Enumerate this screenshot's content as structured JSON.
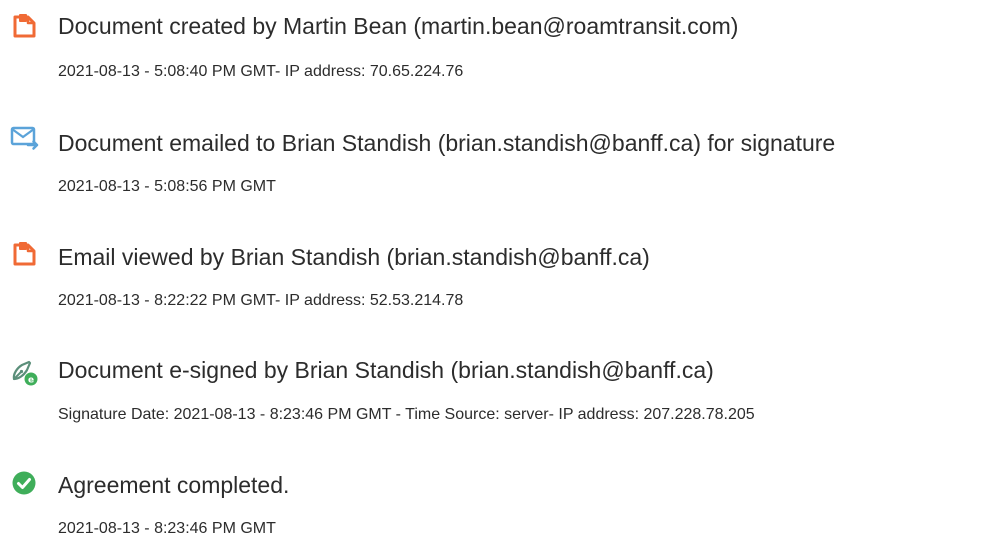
{
  "events": [
    {
      "icon": "document-orange-icon",
      "title": "Document created by Martin Bean (martin.bean@roamtransit.com)",
      "detail": "2021-08-13 - 5:08:40 PM GMT- IP address: 70.65.224.76"
    },
    {
      "icon": "email-send-icon",
      "title": "Document emailed to Brian Standish (brian.standish@banff.ca) for signature",
      "detail": "2021-08-13 - 5:08:56 PM GMT"
    },
    {
      "icon": "document-orange-icon",
      "title": "Email viewed by Brian Standish (brian.standish@banff.ca)",
      "detail": "2021-08-13 - 8:22:22 PM GMT- IP address: 52.53.214.78"
    },
    {
      "icon": "esign-pen-icon",
      "title": "Document e-signed by Brian Standish (brian.standish@banff.ca)",
      "detail": "Signature Date: 2021-08-13 - 8:23:46 PM GMT - Time Source: server- IP address: 207.228.78.205"
    },
    {
      "icon": "check-circle-icon",
      "title": "Agreement completed.",
      "detail": "2021-08-13 - 8:23:46 PM GMT"
    }
  ],
  "colors": {
    "orange": "#F06A35",
    "blue": "#5BA3D9",
    "green": "#3FAE5A",
    "text": "#2c2c2c"
  }
}
